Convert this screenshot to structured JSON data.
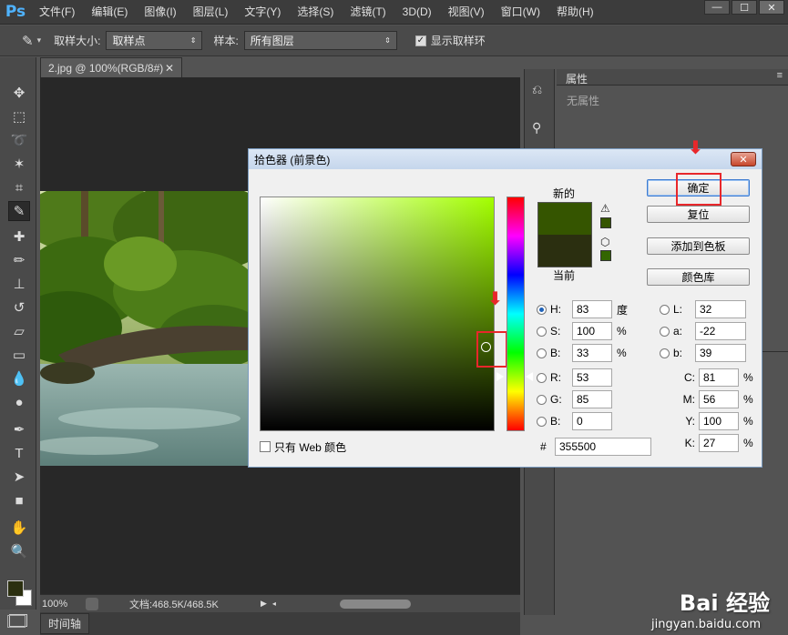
{
  "app": {
    "logo": "Ps"
  },
  "menu": [
    "文件(F)",
    "编辑(E)",
    "图像(I)",
    "图层(L)",
    "文字(Y)",
    "选择(S)",
    "滤镜(T)",
    "3D(D)",
    "视图(V)",
    "窗口(W)",
    "帮助(H)"
  ],
  "window_buttons": {
    "minimize": "—",
    "maximize": "☐",
    "close": "✕"
  },
  "options": {
    "sample_size_label": "取样大小:",
    "sample_size_value": "取样点",
    "sample_label": "样本:",
    "sample_value": "所有图层",
    "show_ring_label": "显示取样环",
    "show_ring_checked": "✓"
  },
  "document": {
    "tab_title": "2.jpg @ 100%(RGB/8#)",
    "tab_close": "✕",
    "zoom": "100%",
    "doc_info": "文档:468.5K/468.5K",
    "timeline_label": "时间轴"
  },
  "properties": {
    "tab": "属性",
    "empty": "无属性"
  },
  "dialog": {
    "title": "拾色器 (前景色)",
    "close": "✕",
    "new_label": "新的",
    "current_label": "当前",
    "new_color": "#355500",
    "current_color": "#2b2f10",
    "web_only_label": "只有 Web 颜色",
    "buttons": {
      "ok": "确定",
      "reset": "复位",
      "add_swatch": "添加到色板",
      "libraries": "颜色库"
    },
    "hsb": [
      {
        "key": "H:",
        "value": "83",
        "unit": "度",
        "selected": true
      },
      {
        "key": "S:",
        "value": "100",
        "unit": "%",
        "selected": false
      },
      {
        "key": "B:",
        "value": "33",
        "unit": "%",
        "selected": false
      }
    ],
    "rgb": [
      {
        "key": "R:",
        "value": "53"
      },
      {
        "key": "G:",
        "value": "85"
      },
      {
        "key": "B:",
        "value": "0"
      }
    ],
    "lab": [
      {
        "key": "L:",
        "value": "32"
      },
      {
        "key": "a:",
        "value": "-22"
      },
      {
        "key": "b:",
        "value": "39"
      }
    ],
    "cmyk": [
      {
        "key": "C:",
        "value": "81",
        "unit": "%"
      },
      {
        "key": "M:",
        "value": "56",
        "unit": "%"
      },
      {
        "key": "Y:",
        "value": "100",
        "unit": "%"
      },
      {
        "key": "K:",
        "value": "27",
        "unit": "%"
      }
    ],
    "hex_label": "#",
    "hex_value": "355500"
  },
  "watermark": {
    "brand": "Bai 经验",
    "url": "jingyan.baidu.com"
  }
}
